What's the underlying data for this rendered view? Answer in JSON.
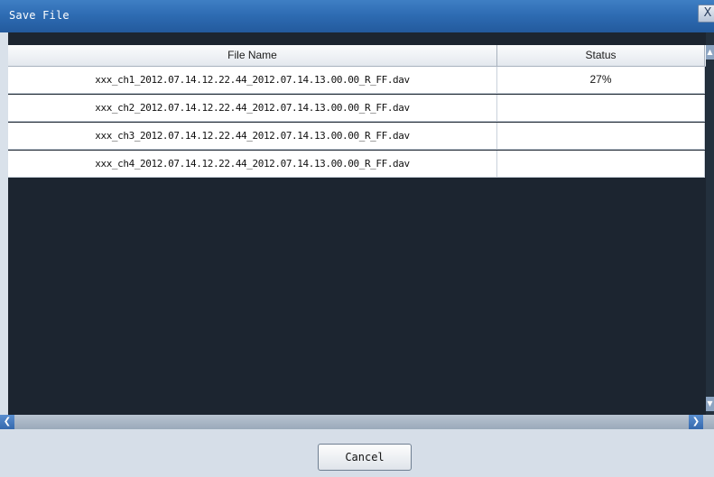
{
  "window": {
    "title": "Save File",
    "close_label": "X"
  },
  "table": {
    "columns": [
      "File Name",
      "Status"
    ],
    "rows": [
      {
        "file_name": "xxx_ch1_2012.07.14.12.22.44_2012.07.14.13.00.00_R_FF.dav",
        "status": "27%"
      },
      {
        "file_name": "xxx_ch2_2012.07.14.12.22.44_2012.07.14.13.00.00_R_FF.dav",
        "status": ""
      },
      {
        "file_name": "xxx_ch3_2012.07.14.12.22.44_2012.07.14.13.00.00_R_FF.dav",
        "status": ""
      },
      {
        "file_name": "xxx_ch4_2012.07.14.12.22.44_2012.07.14.13.00.00_R_FF.dav",
        "status": ""
      }
    ]
  },
  "footer": {
    "cancel_label": "Cancel"
  },
  "icons": {
    "scroll_left": "chevron-left-icon",
    "scroll_right": "chevron-right-icon",
    "scroll_up": "chevron-up-icon",
    "scroll_down": "chevron-down-icon"
  }
}
